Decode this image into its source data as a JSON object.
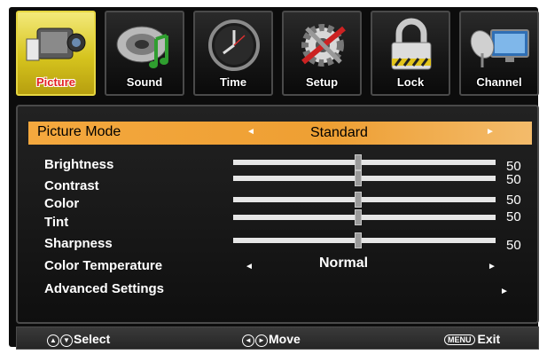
{
  "tabs": [
    {
      "label": "Picture",
      "icon": "camcorder-icon",
      "active": true
    },
    {
      "label": "Sound",
      "icon": "speaker-music-icon",
      "active": false
    },
    {
      "label": "Time",
      "icon": "clock-icon",
      "active": false
    },
    {
      "label": "Setup",
      "icon": "gear-tools-icon",
      "active": false
    },
    {
      "label": "Lock",
      "icon": "padlock-icon",
      "active": false
    },
    {
      "label": "Channel",
      "icon": "satellite-dish-tv-icon",
      "active": false
    }
  ],
  "picture_mode": {
    "label": "Picture Mode",
    "value": "Standard"
  },
  "sliders": [
    {
      "label": "Brightness",
      "value": "50",
      "level": 0.5
    },
    {
      "label": "Contrast",
      "value": "50",
      "level": 0.5
    },
    {
      "label": "Color",
      "value": "50",
      "level": 0.5
    },
    {
      "label": "Tint",
      "value": "50",
      "level": 0.5
    },
    {
      "label": "Sharpness",
      "value": "50",
      "level": 0.5
    }
  ],
  "color_temperature": {
    "label": "Color Temperature",
    "value": "Normal"
  },
  "advanced": {
    "label": "Advanced Settings"
  },
  "footer": {
    "select": "Select",
    "move": "Move",
    "menu_key": "MENU",
    "exit": "Exit"
  },
  "colors": {
    "highlight": "#F0A035",
    "active_tab": "#D6C41E",
    "tab_text_active": "#E32222"
  }
}
